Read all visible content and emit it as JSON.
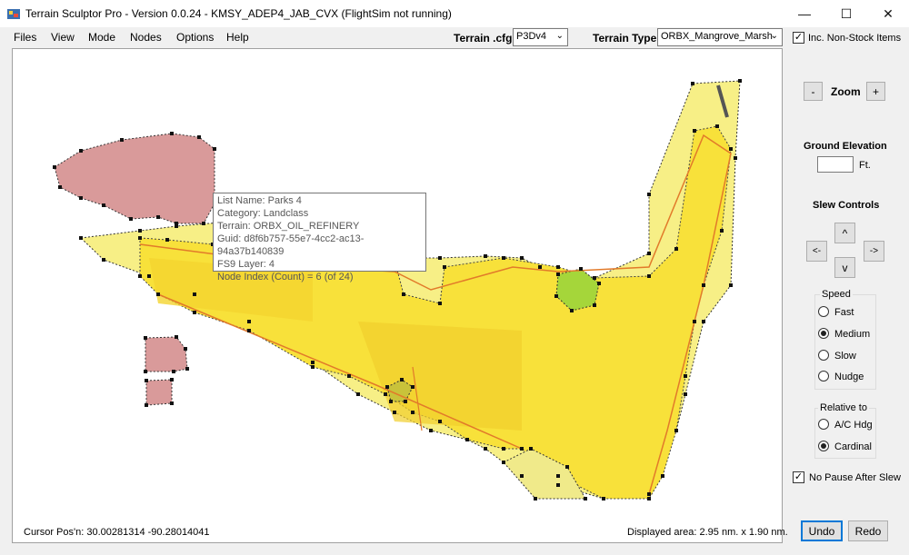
{
  "window": {
    "title": "Terrain Sculptor Pro - Version 0.0.24 - KMSY_ADEP4_JAB_CVX (FlightSim not running)",
    "minimize_glyph": "—",
    "maximize_glyph": "☐",
    "close_glyph": "✕"
  },
  "menu": [
    "Files",
    "View",
    "Mode",
    "Nodes",
    "Options",
    "Help"
  ],
  "toolbar": {
    "terrain_cfg_label": "Terrain .cfg",
    "terrain_cfg_value": "P3Dv4",
    "terrain_type_label": "Terrain Type",
    "terrain_type_value": "ORBX_Mangrove_Marsh",
    "non_stock_label": "Inc. Non-Stock Items",
    "non_stock_checked": "✓"
  },
  "tooltip": {
    "lines": [
      "List Name: Parks 4",
      "Category: Landclass",
      "Terrain: ORBX_OIL_REFINERY",
      "Guid: d8f6b757-55e7-4cc2-ac13-94a37b140839",
      "FS9 Layer: 4",
      "Node Index (Count) = 6 (of 24)"
    ]
  },
  "status": {
    "cursor": "Cursor Pos'n: 30.00281314 -90.28014041",
    "displayed": "Displayed area: 2.95 nm. x 1.90 nm."
  },
  "side": {
    "zoom_minus": "-",
    "zoom_label": "Zoom",
    "zoom_plus": "+",
    "ground_elev_label": "Ground Elevation",
    "ground_elev_unit": "Ft.",
    "slew_label": "Slew Controls",
    "slew_up": "^",
    "slew_left": "<-",
    "slew_right": "->",
    "slew_down": "v",
    "speed_title": "Speed",
    "speed_options": [
      "Fast",
      "Medium",
      "Slow",
      "Nudge"
    ],
    "relative_title": "Relative to",
    "relative_options": [
      "A/C Hdg",
      "Cardinal"
    ],
    "no_pause_label": "No Pause After Slew",
    "no_pause_checked": "✓",
    "undo": "Undo",
    "redo": "Redo"
  },
  "colors": {
    "landclass_yellow": "#f8e13a",
    "landclass_pink": "#d99a9a",
    "landclass_green": "#a5d63a",
    "node": "#111111",
    "accent": "#0078d7"
  }
}
